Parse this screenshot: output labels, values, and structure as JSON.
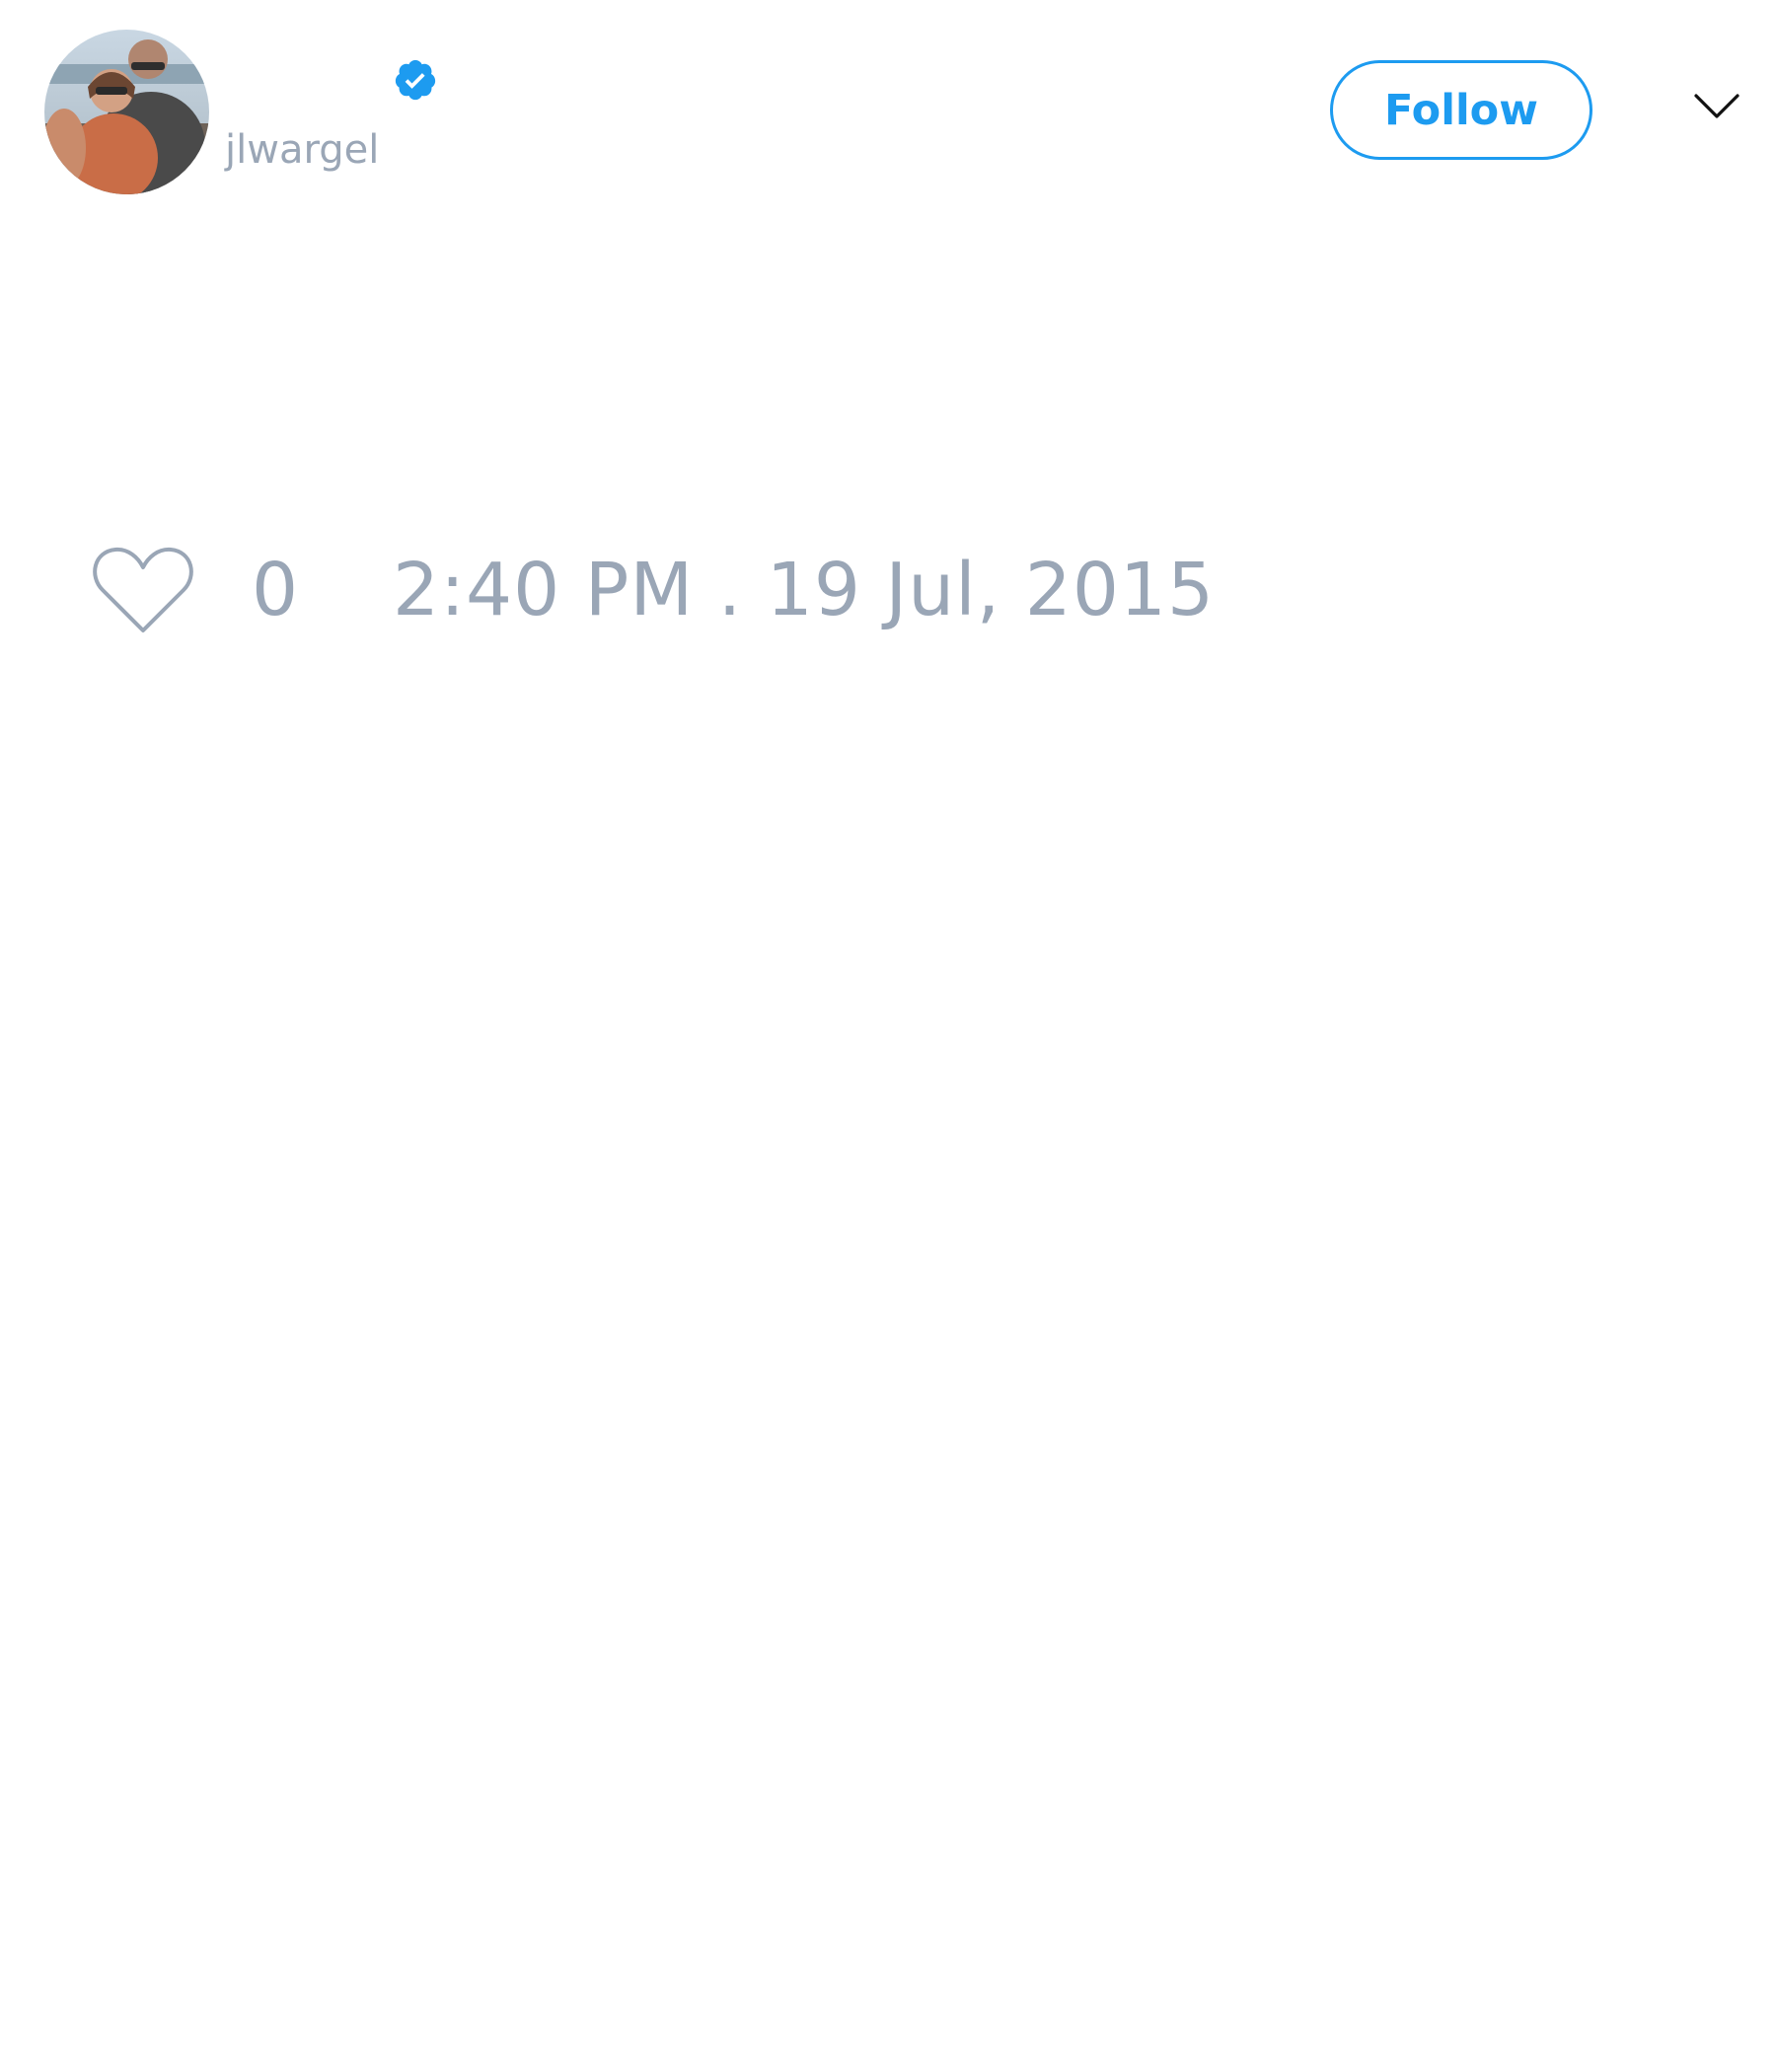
{
  "header": {
    "handle": "jlwargel",
    "follow_label": "Follow"
  },
  "icons": {
    "avatar": "profile-photo",
    "verified": "verified-badge-icon",
    "menu": "chevron-down-icon",
    "like": "heart-icon"
  },
  "footer": {
    "like_count": "0",
    "timestamp": "2:40 PM . 19 Jul, 2015"
  },
  "colors": {
    "accent": "#1d9bf0",
    "muted_text": "#9aa6b6",
    "background": "#ffffff"
  }
}
